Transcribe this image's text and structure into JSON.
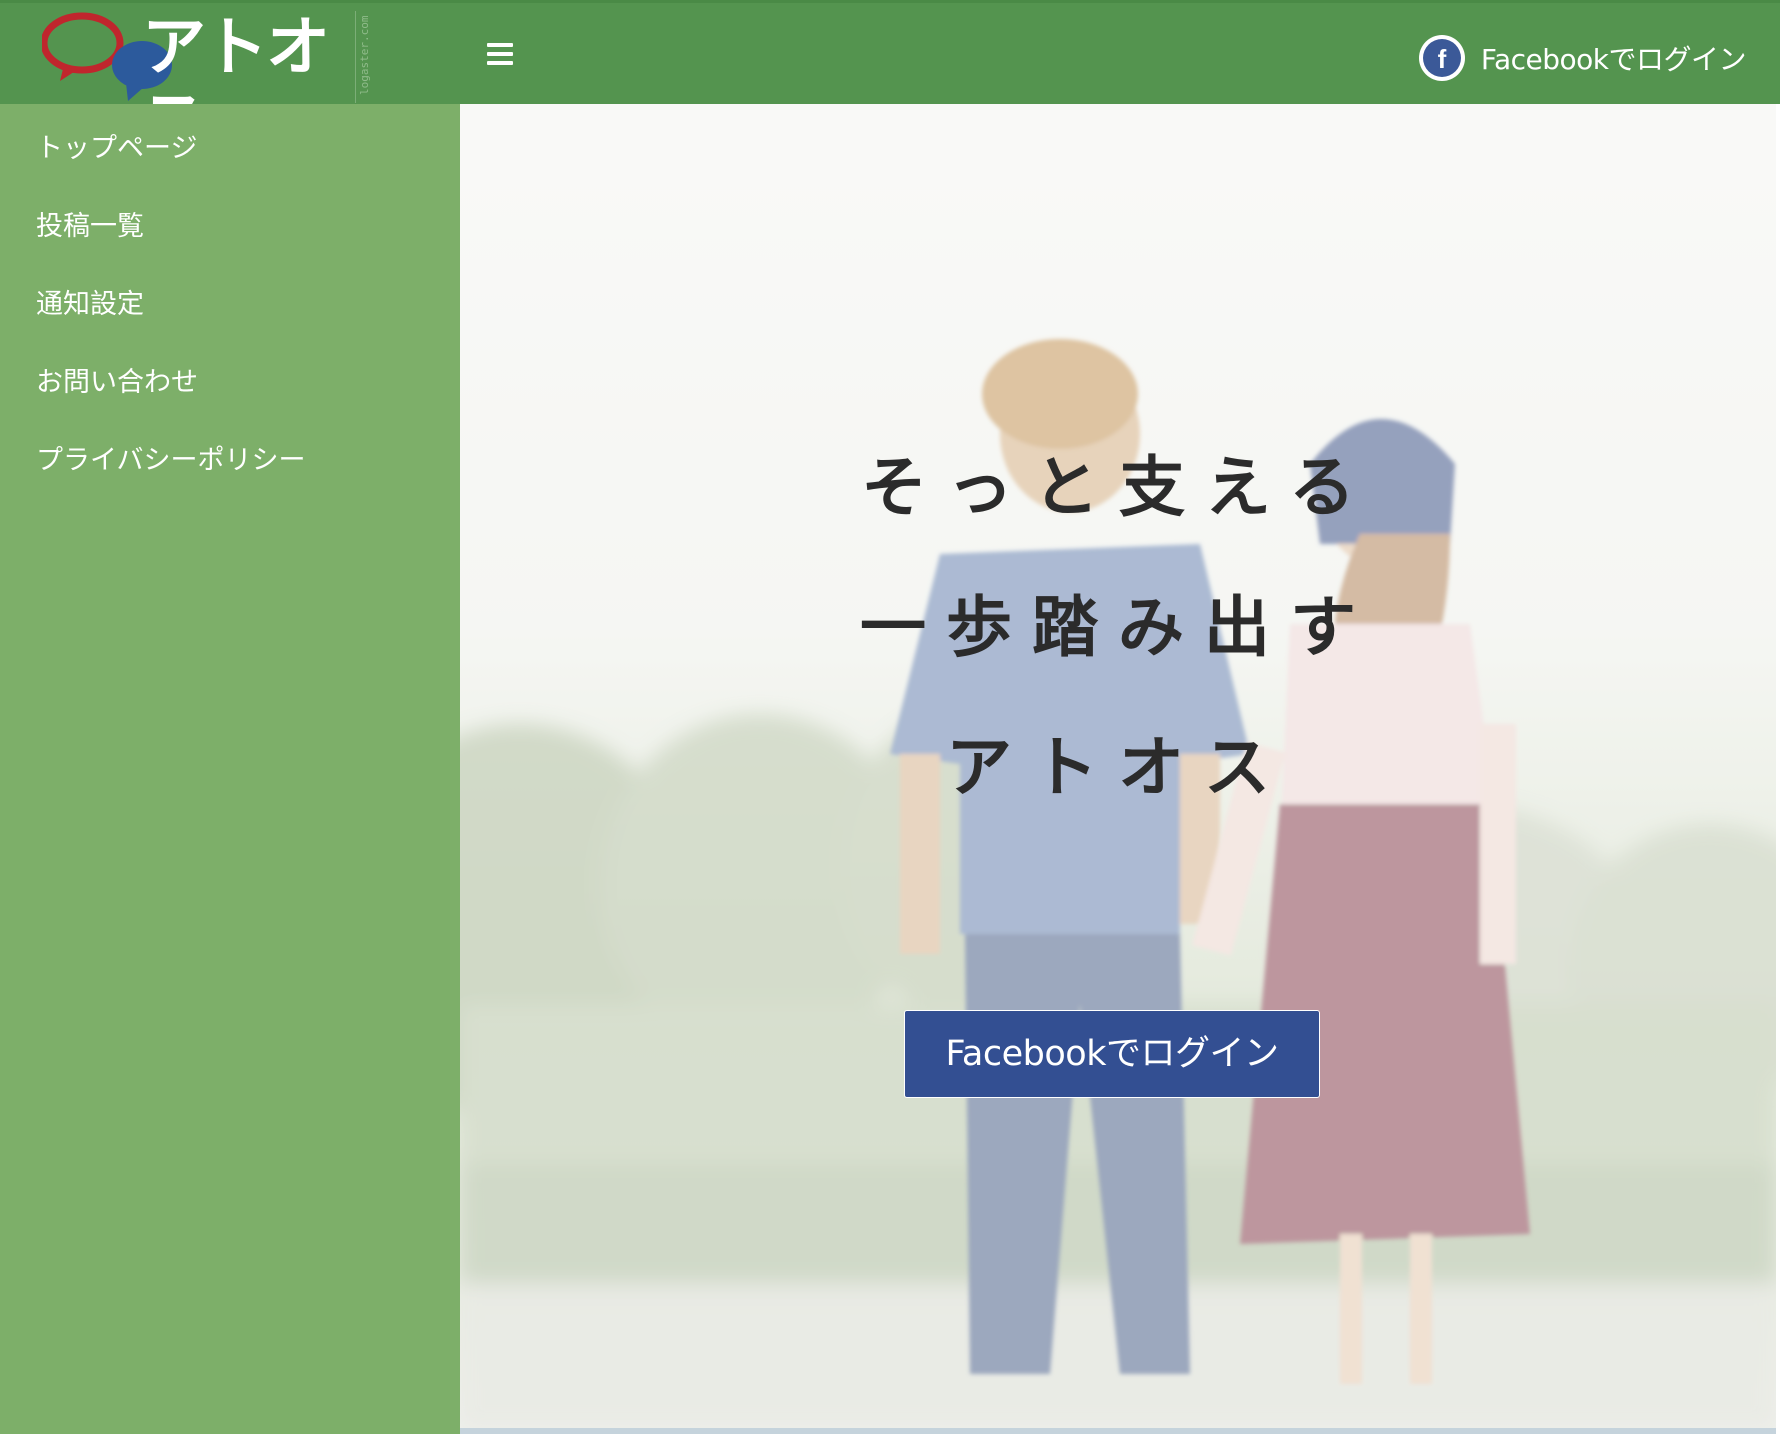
{
  "header": {
    "logo_text": "アトオス",
    "logo_sub": "logaster.com",
    "login_label": "Facebookでログイン",
    "background": "#54944f"
  },
  "sidebar": {
    "background": "#7daf69",
    "items": [
      {
        "label": "トップページ"
      },
      {
        "label": "投稿一覧"
      },
      {
        "label": "通知設定"
      },
      {
        "label": "お問い合わせ"
      },
      {
        "label": "プライバシーポリシー"
      }
    ]
  },
  "hero": {
    "lines": [
      "そっと支える",
      "一歩踏み出す",
      "アトオス"
    ],
    "cta_label": "Facebookでログイン",
    "cta_color": "#334f92"
  }
}
